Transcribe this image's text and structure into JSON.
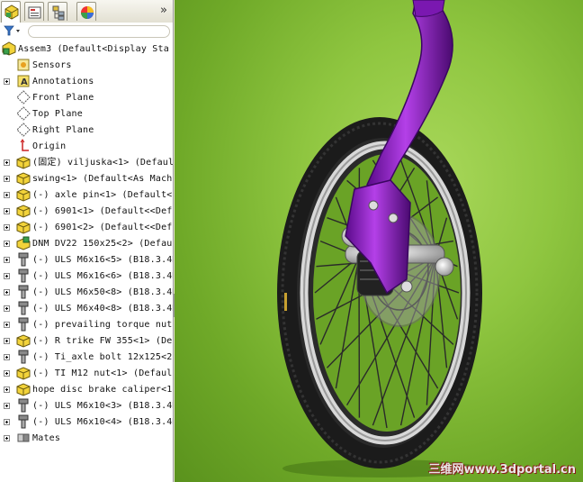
{
  "panel": {
    "tabs": [
      "feature-manager",
      "property-manager",
      "configuration-manager",
      "display-manager"
    ],
    "more_label": "»"
  },
  "tree": [
    {
      "label": "Assem3  (Default<Display Sta",
      "icon": "assembly-icon",
      "expand": false
    },
    {
      "label": "Sensors",
      "icon": "sensor-icon",
      "expand": false
    },
    {
      "label": "Annotations",
      "icon": "annotation-icon",
      "expand": true
    },
    {
      "label": "Front Plane",
      "icon": "plane-icon",
      "expand": false
    },
    {
      "label": "Top Plane",
      "icon": "plane-icon",
      "expand": false
    },
    {
      "label": "Right Plane",
      "icon": "plane-icon",
      "expand": false
    },
    {
      "label": "Origin",
      "icon": "origin-icon",
      "expand": false
    },
    {
      "label": "(固定) viljuska<1> (Defaul",
      "icon": "part-icon",
      "expand": true
    },
    {
      "label": "swing<1> (Default<As Mach",
      "icon": "part-icon",
      "expand": true
    },
    {
      "label": "(-) axle pin<1> (Default<",
      "icon": "part-icon",
      "expand": true
    },
    {
      "label": "(-) 6901<1> (Default<<Def",
      "icon": "part-icon",
      "expand": true
    },
    {
      "label": "(-) 6901<2> (Default<<Def",
      "icon": "part-icon",
      "expand": true
    },
    {
      "label": "DNM DV22 150x25<2> (Defaul",
      "icon": "subassembly-icon",
      "expand": true
    },
    {
      "label": "(-) ULS M6x16<5> (B18.3.4M",
      "icon": "bolt-icon",
      "expand": true
    },
    {
      "label": "(-) ULS M6x16<6> (B18.3.4M",
      "icon": "bolt-icon",
      "expand": true
    },
    {
      "label": "(-) ULS M6x50<8> (B18.3.4M",
      "icon": "bolt-icon",
      "expand": true
    },
    {
      "label": "(-) ULS M6x40<8> (B18.3.4M",
      "icon": "bolt-icon",
      "expand": true
    },
    {
      "label": "(-) prevailing torque nut",
      "icon": "bolt-icon",
      "expand": true
    },
    {
      "label": "(-) R trike FW 355<1> (De",
      "icon": "part-icon",
      "expand": true
    },
    {
      "label": "(-) Ti_axle bolt 12x125<2",
      "icon": "bolt-icon",
      "expand": true
    },
    {
      "label": "(-) TI M12 nut<1> (Defaul",
      "icon": "part-icon",
      "expand": true
    },
    {
      "label": "hope disc brake caliper<1",
      "icon": "part-icon",
      "expand": true
    },
    {
      "label": "(-) ULS M6x10<3> (B18.3.4M",
      "icon": "bolt-icon",
      "expand": true
    },
    {
      "label": "(-) ULS M6x10<4> (B18.3.4M",
      "icon": "bolt-icon",
      "expand": true
    },
    {
      "label": "Mates",
      "icon": "mates-icon",
      "expand": true
    }
  ],
  "viewport": {
    "watermark": "三维网www.3dportal.cn"
  }
}
